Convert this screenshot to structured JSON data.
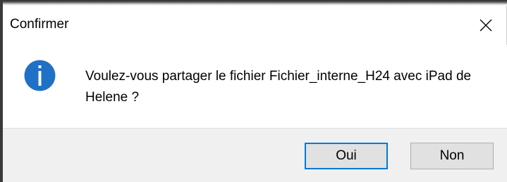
{
  "window": {
    "title": "Confirmer",
    "close_icon": "close-icon"
  },
  "message": {
    "icon": "info-icon",
    "text": "Voulez-vous partager le fichier Fichier_interne_H24 avec iPad de Helene ?"
  },
  "buttons": {
    "yes_label": "Oui",
    "no_label": "Non"
  },
  "colors": {
    "icon_blue": "#1f71c5",
    "focus_border": "#0078d7",
    "footer_bg": "#f0f0f0"
  }
}
